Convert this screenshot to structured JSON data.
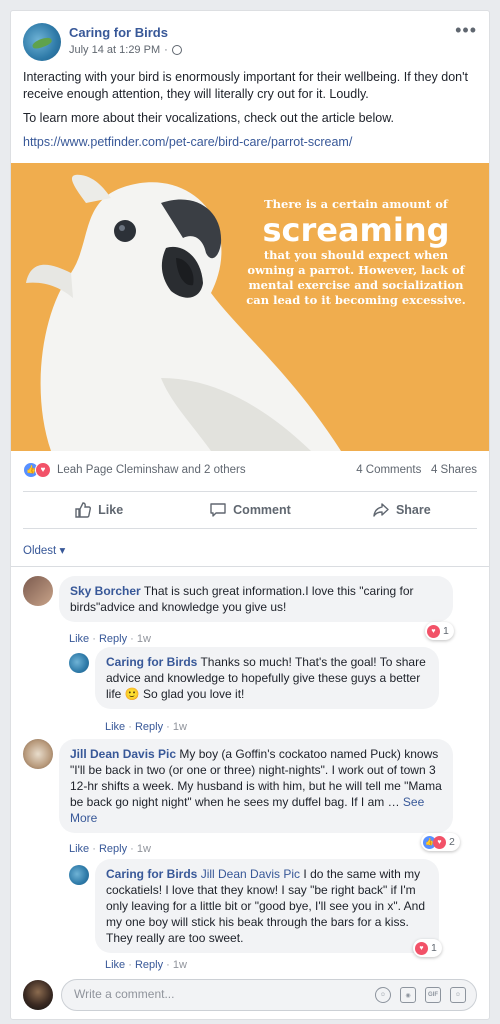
{
  "post": {
    "page_name": "Caring for Birds",
    "date": "July 14 at 1:29 PM",
    "separator": "·",
    "paragraphs": [
      "Interacting with your bird is enormously important for their wellbeing. If they don't receive enough attention, they will literally cry out for it. Loudly.",
      "To learn more about their vocalizations, check out the article below."
    ],
    "link": "https://www.petfinder.com/pet-care/bird-care/parrot-scream/",
    "image_text": {
      "line1": "There is a certain amount of",
      "big": "screaming",
      "rest": "that you should expect when owning a parrot. However, lack of mental exercise and socialization can lead to it becoming excessive."
    },
    "reactors": "Leah Page Cleminshaw and 2 others",
    "comments_count": "4 Comments",
    "shares_count": "4 Shares"
  },
  "actions": {
    "like": "Like",
    "comment": "Comment",
    "share": "Share"
  },
  "sort_label": "Oldest",
  "comments": [
    {
      "author": "Sky Borcher",
      "text": "That is such great information.I love this \"caring for birds\"advice and knowledge you give us!",
      "like": "Like",
      "reply": "Reply",
      "time": "1w",
      "reaction_count": "1",
      "reply_item": {
        "author": "Caring for Birds",
        "text_before": "Thanks so much! That's the goal! To share advice and knowledge to hopefully give these guys a better life",
        "emoji": "🙂",
        "text_after": "So glad you love it!",
        "like": "Like",
        "reply": "Reply",
        "time": "1w"
      }
    },
    {
      "author": "Jill Dean Davis Pic",
      "text": "My boy (a Goffin's cockatoo named Puck) knows \"I'll be back in two (or one or three) night-nights\". I work out of town 3 12-hr shifts a week. My husband is with him, but he will tell me \"Mama be back go night night\" when he sees my duffel bag. If I am …",
      "see_more": "See More",
      "like": "Like",
      "reply": "Reply",
      "time": "1w",
      "reaction_count": "2",
      "reply_item": {
        "author": "Caring for Birds",
        "mention": "Jill Dean Davis Pic",
        "text": "I do the same with my cockatiels! I love that they know! I say \"be right back\" if I'm only leaving for a little bit or \"good bye, I'll see you in x\". And my one boy will stick his beak through the bars for a kiss. They really are too sweet.",
        "like": "Like",
        "reply": "Reply",
        "time": "1w",
        "reaction_count": "1"
      }
    }
  ],
  "composer": {
    "placeholder": "Write a comment..."
  },
  "colors": {
    "link": "#385898",
    "like_blue": "#5890ff",
    "love_red": "#f25268",
    "image_bg": "#f0ad4e"
  },
  "icons": [
    "globe-icon",
    "more-icon",
    "like-icon",
    "comment-icon",
    "share-icon",
    "emoji-icon",
    "camera-icon",
    "gif-icon",
    "sticker-icon"
  ]
}
